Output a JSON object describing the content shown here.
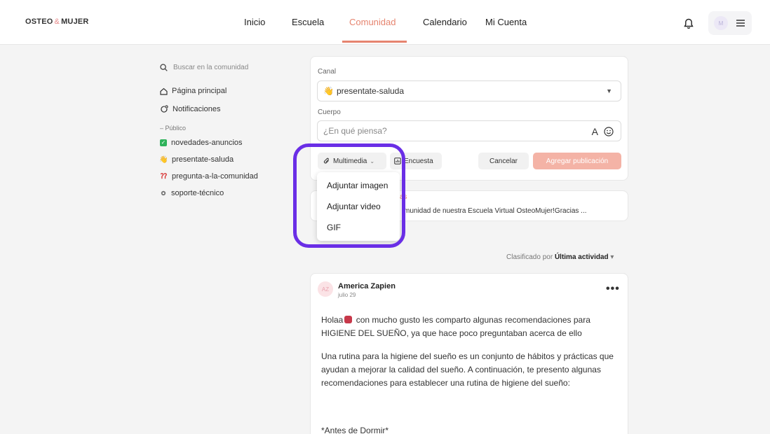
{
  "brand": {
    "logo_left": "OSTEO",
    "logo_amp": "&",
    "logo_right": "MUJER"
  },
  "nav": {
    "items": [
      "Inicio",
      "Escuela",
      "Comunidad",
      "Calendario",
      "Mi Cuenta"
    ],
    "active_index": 2
  },
  "user": {
    "initials": "M"
  },
  "sidebar": {
    "search_placeholder": "Buscar en la comunidad",
    "home": "Página principal",
    "notifications": "Notificaciones",
    "section": "– Público",
    "channels": [
      "novedades-anuncios",
      "presentate-saluda",
      "pregunta-a-la-comunidad",
      "soporte-técnico"
    ]
  },
  "composer": {
    "channel_label": "Canal",
    "channel_value": "presentate-saluda",
    "body_label": "Cuerpo",
    "body_placeholder": "¿En qué piensa?",
    "multimedia": "Multimedia",
    "poll": "Encuesta",
    "cancel": "Cancelar",
    "publish": "Agregar publicación"
  },
  "dropdown": {
    "items": [
      "Adjuntar imagen",
      "Adjuntar video",
      "GIF"
    ]
  },
  "pinned": {
    "title_fragment": "as",
    "text_fragment": "munidad de nuestra Escuela Virtual OsteoMujer!Gracias ..."
  },
  "sort": {
    "prefix": "Clasificado por",
    "value": "Última actividad"
  },
  "post": {
    "avatar_initials": "AZ",
    "author": "America Zapien",
    "date": "julio 29",
    "p1_a": "Holaa",
    "p1_b": "con mucho gusto les comparto algunas recomendaciones para HIGIENE DEL SUEÑO, ya que hace poco preguntaban acerca de ello",
    "p2": "Una rutina para la higiene del sueño es un conjunto de hábitos y prácticas que ayudan a mejorar la calidad del sueño. A continuación, te presento algunas recomendaciones para establecer una rutina de higiene del sueño:",
    "p3": "*Antes de Dormir*"
  },
  "colors": {
    "accent": "#e6846f",
    "highlight": "#6a2ee6",
    "publish_button": "#f4b3a6"
  }
}
